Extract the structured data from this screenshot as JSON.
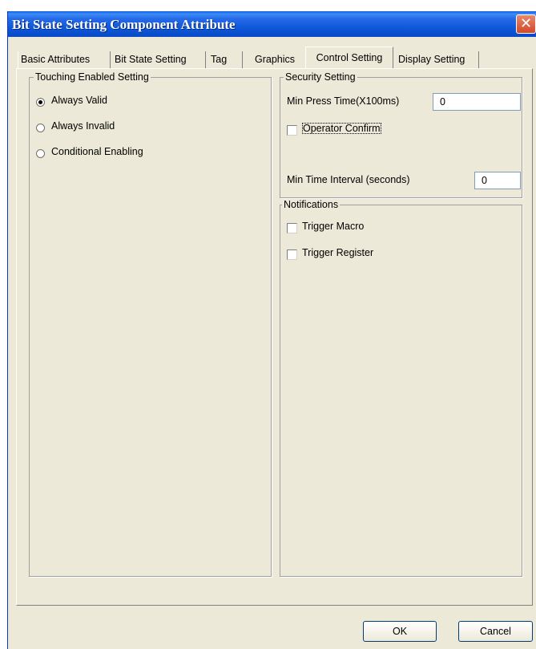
{
  "window": {
    "title": "Bit State Setting Component Attribute",
    "close_glyph": "✕"
  },
  "tabs": [
    {
      "label": "Basic Attributes",
      "active": false
    },
    {
      "label": "Bit State Setting",
      "active": false
    },
    {
      "label": "Tag",
      "active": false
    },
    {
      "label": "Graphics",
      "active": false
    },
    {
      "label": "Control Setting",
      "active": true
    },
    {
      "label": "Display Setting",
      "active": false
    }
  ],
  "touching": {
    "legend": "Touching Enabled Setting",
    "options": [
      {
        "label": "Always Valid",
        "selected": true
      },
      {
        "label": "Always Invalid",
        "selected": false
      },
      {
        "label": "Conditional Enabling",
        "selected": false
      }
    ]
  },
  "security": {
    "legend": "Security Setting",
    "min_press_label": "Min Press Time(X100ms)",
    "min_press_value": "0",
    "operator_confirm_label": "Operator Confirm",
    "operator_confirm_checked": false,
    "min_interval_label": "Min Time Interval (seconds)",
    "min_interval_value": "0"
  },
  "notifications": {
    "legend": "Notifications",
    "trigger_macro_label": "Trigger Macro",
    "trigger_macro_checked": false,
    "trigger_register_label": "Trigger Register",
    "trigger_register_checked": false
  },
  "buttons": {
    "ok": "OK",
    "cancel": "Cancel"
  },
  "colors": {
    "titlebar": "#0a5de6",
    "dialog_bg": "#ece9d8",
    "close_button": "#d4472a"
  }
}
